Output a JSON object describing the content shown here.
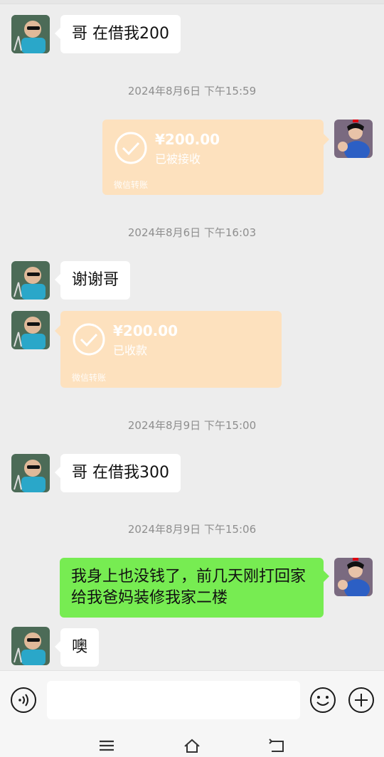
{
  "messages": [
    {
      "text": "哥 在借我200"
    },
    {
      "text": "谢谢哥"
    },
    {
      "text": "哥 在借我300"
    },
    {
      "text": "我身上也没钱了，前几天刚打回家",
      "text2": "给我爸妈装修我家二楼"
    },
    {
      "text": "噢"
    }
  ],
  "timestamps": [
    "2024年8月6日 下午15:59",
    "2024年8月6日 下午16:03",
    "2024年8月9日 下午15:00",
    "2024年8月9日 下午15:06"
  ],
  "transfers": [
    {
      "amount": "¥200.00",
      "status": "已被接收",
      "footer": "微信转账"
    },
    {
      "amount": "¥200.00",
      "status": "已收款",
      "footer": "微信转账"
    }
  ],
  "input": {
    "placeholder": ""
  },
  "icons": {
    "voice": "voice-icon",
    "emoji": "emoji-icon",
    "plus": "plus-icon",
    "nav_menu": "menu-icon",
    "nav_home": "home-icon",
    "nav_back": "back-icon"
  },
  "colors": {
    "background": "#ededed",
    "green_bubble": "#77ec52",
    "transfer": "#fde1be"
  }
}
